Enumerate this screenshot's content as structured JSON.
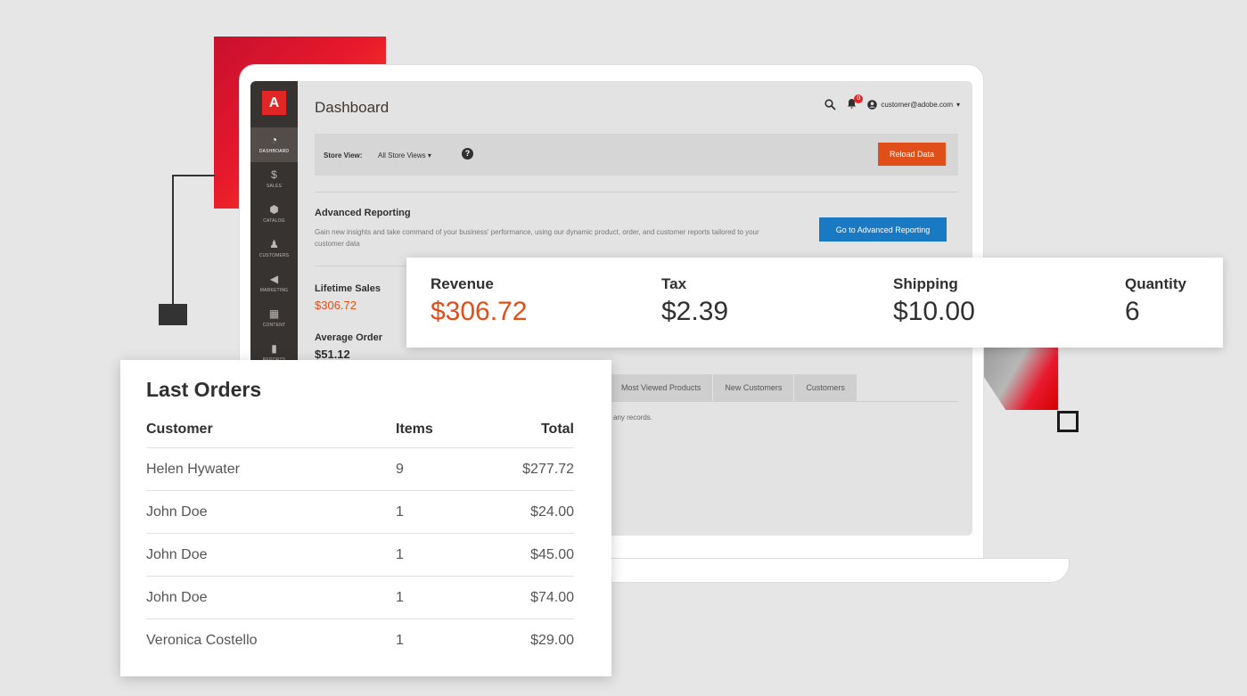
{
  "app": {
    "logo_text": "A",
    "page_title": "Dashboard",
    "user_email": "customer@adobe.com",
    "notification_count": "0",
    "accent_color": "#e04f1a",
    "primary_color": "#1979c3"
  },
  "sidebar": {
    "items": [
      {
        "label": "DASHBOARD",
        "icon": "speedometer-icon",
        "glyph": "◔"
      },
      {
        "label": "SALES",
        "icon": "dollar-icon",
        "glyph": "$"
      },
      {
        "label": "CATALOG",
        "icon": "cube-icon",
        "glyph": "⬢"
      },
      {
        "label": "CUSTOMERS",
        "icon": "person-icon",
        "glyph": "♟"
      },
      {
        "label": "MARKETING",
        "icon": "megaphone-icon",
        "glyph": "◀"
      },
      {
        "label": "CONTENT",
        "icon": "layout-icon",
        "glyph": "▦"
      },
      {
        "label": "REPORTS",
        "icon": "bar-chart-icon",
        "glyph": "▮"
      }
    ]
  },
  "store_bar": {
    "label": "Store View:",
    "selected": "All Store Views",
    "reload_label": "Reload Data"
  },
  "advanced_reporting": {
    "title": "Advanced Reporting",
    "description": "Gain new insights and take command of your business' performance, using our dynamic product, order, and customer reports tailored to your customer data",
    "button_label": "Go to Advanced Reporting"
  },
  "stats": {
    "lifetime_label": "Lifetime Sales",
    "lifetime_value": "$306.72",
    "average_label": "Average Order",
    "average_value": "$51.12"
  },
  "tabs": [
    "Most Viewed Products",
    "New Customers",
    "Customers"
  ],
  "no_records_text": "any records.",
  "metrics": [
    {
      "label": "Revenue",
      "value": "$306.72"
    },
    {
      "label": "Tax",
      "value": "$2.39"
    },
    {
      "label": "Shipping",
      "value": "$10.00"
    },
    {
      "label": "Quantity",
      "value": "6"
    }
  ],
  "last_orders": {
    "title": "Last Orders",
    "columns": [
      "Customer",
      "Items",
      "Total"
    ],
    "rows": [
      {
        "customer": "Helen Hywater",
        "items": "9",
        "total": "$277.72"
      },
      {
        "customer": "John Doe",
        "items": "1",
        "total": "$24.00"
      },
      {
        "customer": "John Doe",
        "items": "1",
        "total": "$45.00"
      },
      {
        "customer": "John Doe",
        "items": "1",
        "total": "$74.00"
      },
      {
        "customer": "Veronica Costello",
        "items": "1",
        "total": "$29.00"
      }
    ]
  }
}
